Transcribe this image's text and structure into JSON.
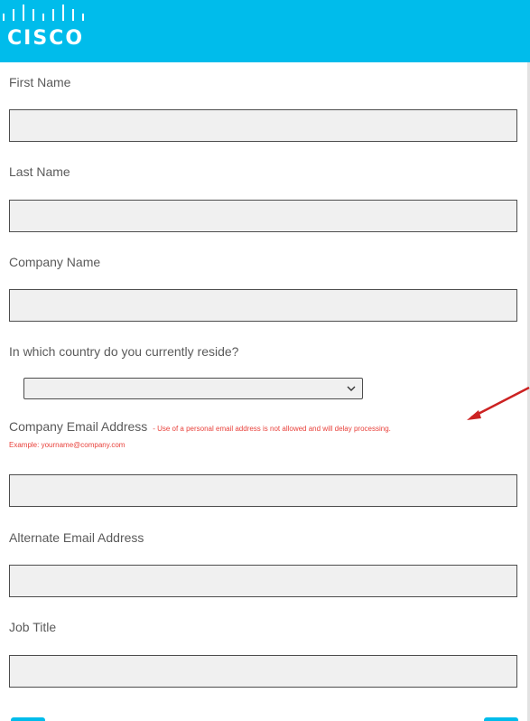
{
  "brand": {
    "logo_text": "CISCO",
    "header_color": "#00bceb"
  },
  "form": {
    "first_name": {
      "label": "First Name",
      "value": ""
    },
    "last_name": {
      "label": "Last Name",
      "value": ""
    },
    "company_name": {
      "label": "Company Name",
      "value": ""
    },
    "country": {
      "label": "In which country do you currently reside?",
      "selected": ""
    },
    "company_email": {
      "label": "Company Email Address",
      "warning": "- Use of a personal email address is not allowed and will delay processing.",
      "example": "Example: yourname@company.com",
      "value": ""
    },
    "alternate_email": {
      "label": "Alternate Email Address",
      "value": ""
    },
    "job_title": {
      "label": "Job Title",
      "value": ""
    }
  },
  "colors": {
    "warning": "#e8413b",
    "arrow": "#cc2222",
    "field_bg": "#f0f0f0",
    "field_border": "#4d4d4d"
  },
  "icons": {
    "logo": "cisco-bridge-logo-icon",
    "dropdown": "chevron-down-icon",
    "annotation": "red-arrow-icon"
  }
}
